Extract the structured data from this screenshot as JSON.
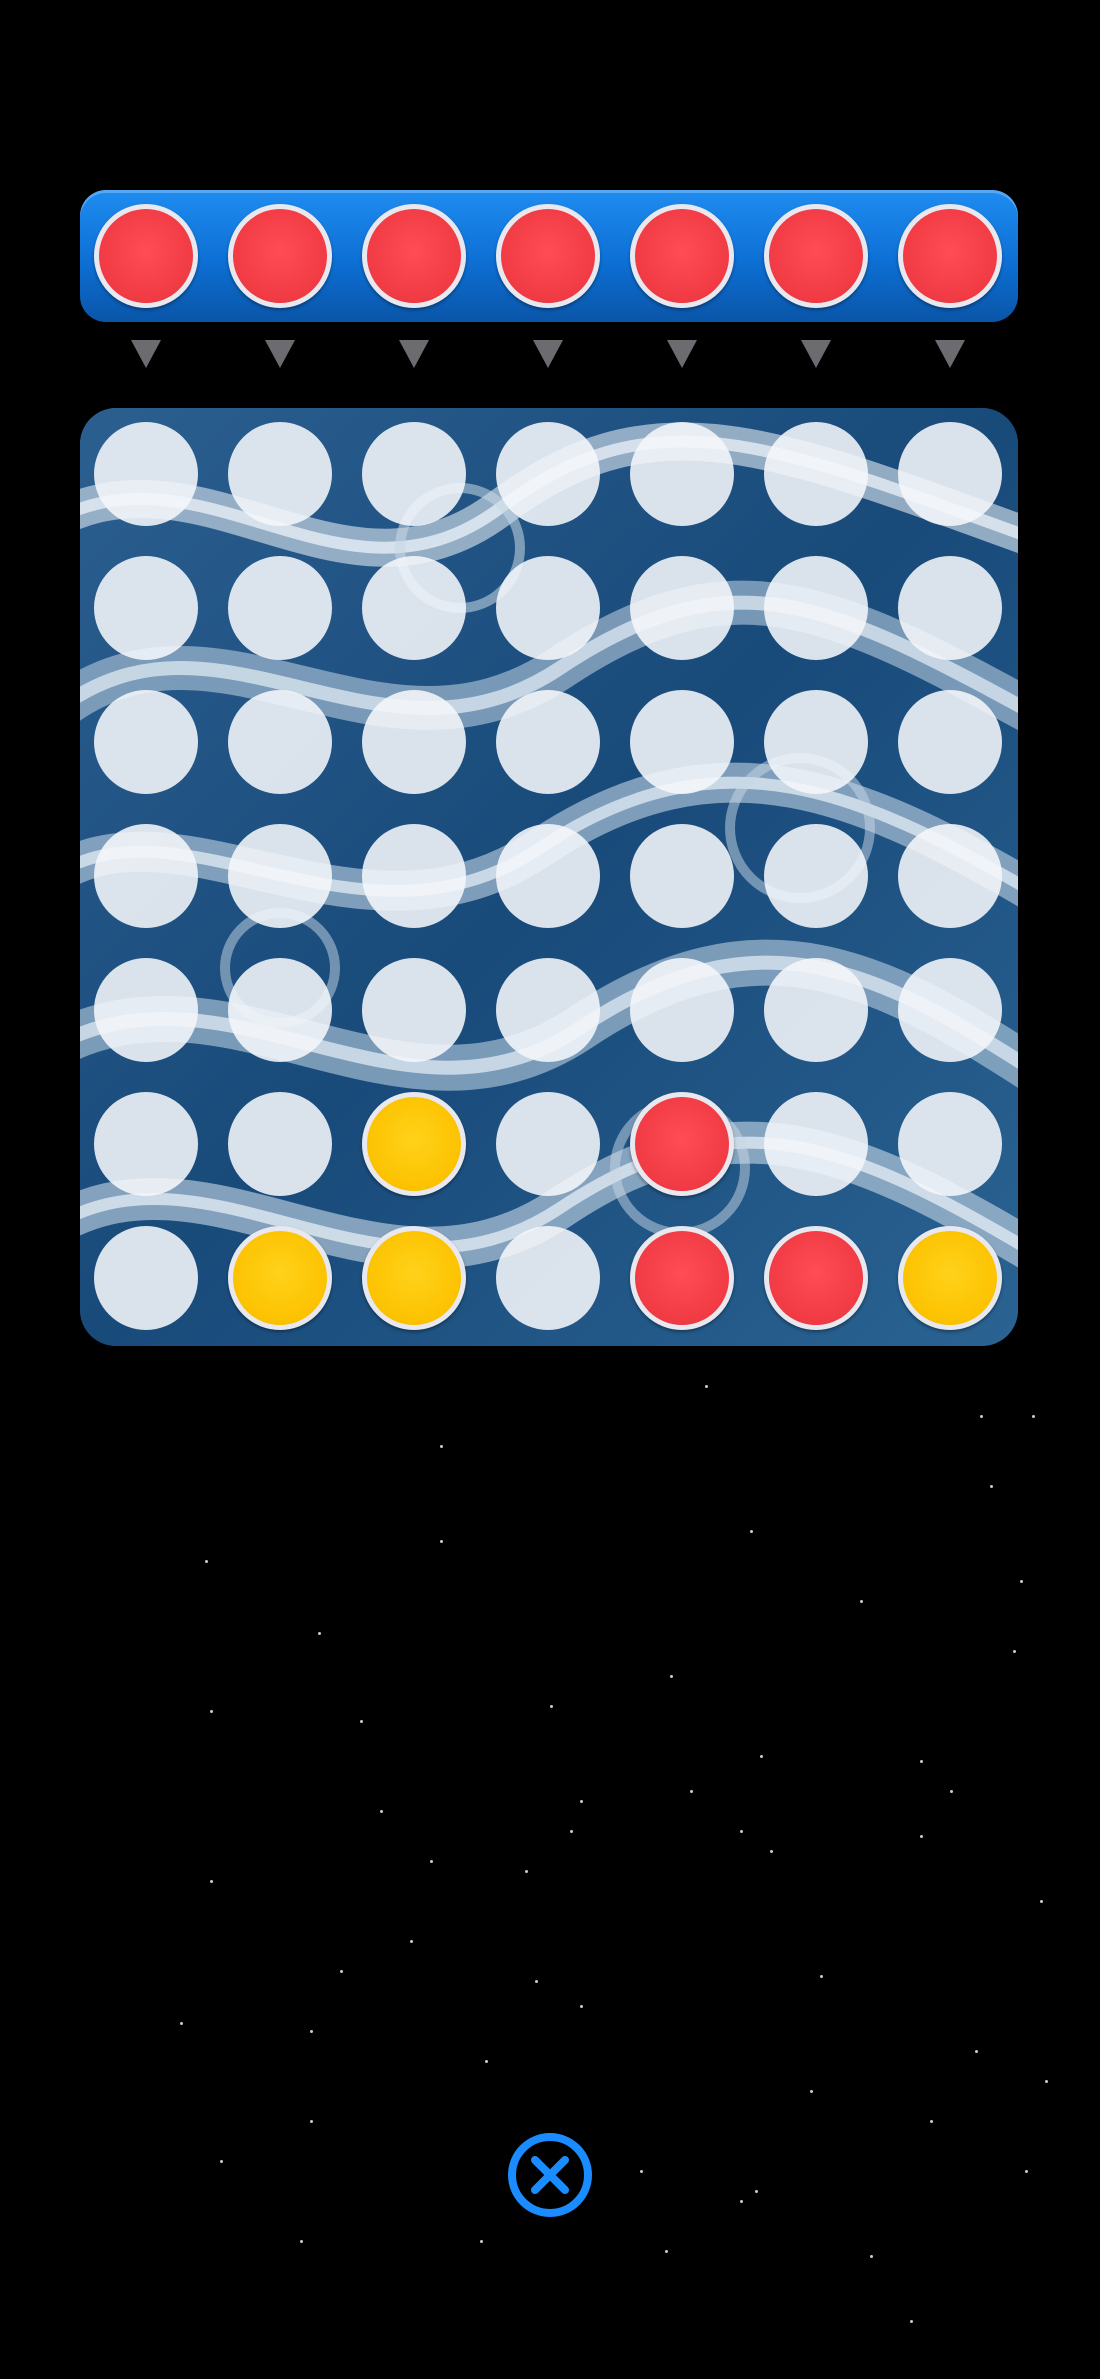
{
  "game": {
    "columns": 7,
    "rows": 7,
    "current_player_color": "red",
    "drop_row": [
      "red",
      "red",
      "red",
      "red",
      "red",
      "red",
      "red"
    ],
    "board": [
      [
        "empty",
        "empty",
        "empty",
        "empty",
        "empty",
        "empty",
        "empty"
      ],
      [
        "empty",
        "empty",
        "empty",
        "empty",
        "empty",
        "empty",
        "empty"
      ],
      [
        "empty",
        "empty",
        "empty",
        "empty",
        "empty",
        "empty",
        "empty"
      ],
      [
        "empty",
        "empty",
        "empty",
        "empty",
        "empty",
        "empty",
        "empty"
      ],
      [
        "empty",
        "empty",
        "empty",
        "empty",
        "empty",
        "empty",
        "empty"
      ],
      [
        "empty",
        "empty",
        "yellow",
        "empty",
        "red",
        "empty",
        "empty"
      ],
      [
        "empty",
        "yellow",
        "yellow",
        "empty",
        "red",
        "red",
        "yellow"
      ]
    ]
  },
  "colors": {
    "red": "#f03a44",
    "yellow": "#fcc200",
    "drop_row_blue": "#1f8cf0",
    "close_button_blue": "#1a8cff",
    "arrow_gray": "#6b6b70"
  },
  "icons": {
    "close": "close-circle-icon",
    "arrow": "triangle-down-icon"
  }
}
